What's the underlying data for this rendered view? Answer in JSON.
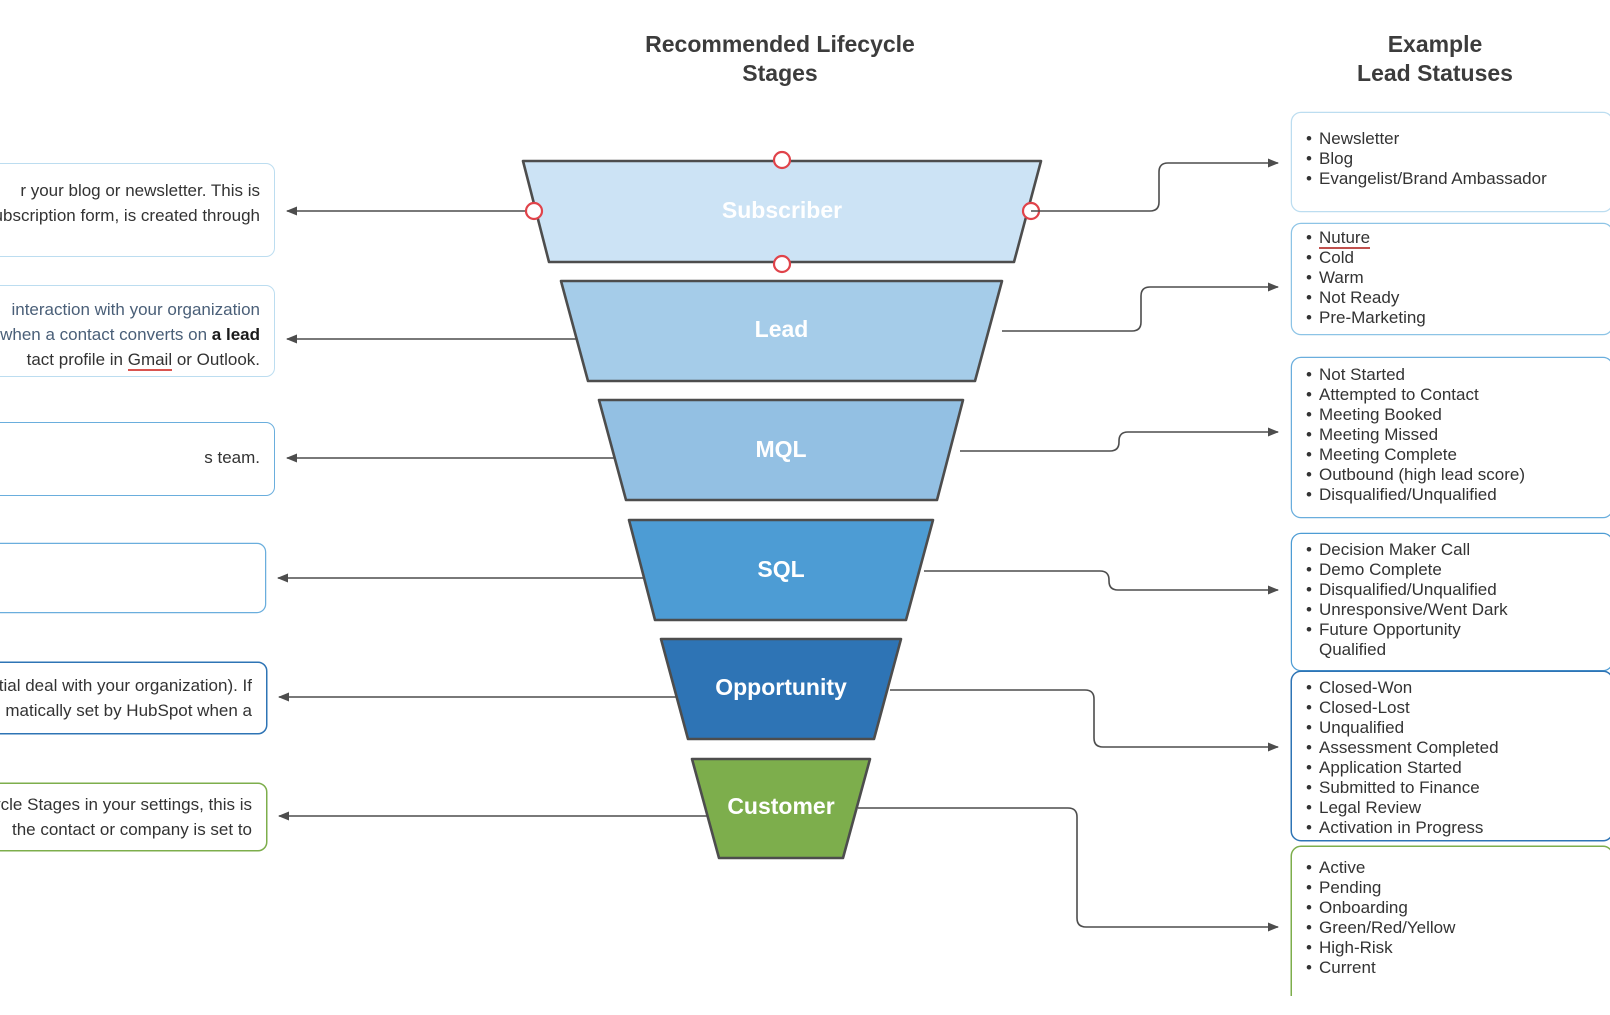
{
  "headers": {
    "funnel": "Recommended Lifecycle\nStages",
    "statuses": "Example\nLead Statuses"
  },
  "colors": {
    "subscriber": "#cce3f5",
    "lead": "#a5cce9",
    "mql": "#93c0e3",
    "sql": "#4d9cd4",
    "opportunity": "#2e74b5",
    "customer": "#7dae4c",
    "shape_stroke": "#4d4d4d",
    "connector": "#595959",
    "handle_red": "#e0434a",
    "box_border_light": "#bcddf0",
    "box_border_mid": "#6aaedd",
    "box_border_blue": "#2e74b5",
    "box_border_green": "#7dae4c",
    "text": "#333333",
    "spellcheck_underline": "#c0504d"
  },
  "funnel": {
    "stages": [
      {
        "id": "subscriber",
        "label": "Subscriber",
        "font_size": 23,
        "selected": true
      },
      {
        "id": "lead",
        "label": "Lead",
        "font_size": 23,
        "selected": false
      },
      {
        "id": "mql",
        "label": "MQL",
        "font_size": 23,
        "selected": false
      },
      {
        "id": "sql",
        "label": "SQL",
        "font_size": 23,
        "selected": false
      },
      {
        "id": "opportunity",
        "label": "Opportunity",
        "font_size": 23,
        "selected": false
      },
      {
        "id": "customer",
        "label": "Customer",
        "font_size": 23,
        "selected": false
      }
    ]
  },
  "descriptions": [
    {
      "id": "subscriber-description",
      "lines": [
        [
          {
            "t": "r your blog or newsletter. This is",
            "s": "normal"
          }
        ],
        [
          {
            "t": "ubscription form, is created through",
            "s": "normal"
          }
        ]
      ]
    },
    {
      "id": "lead-description",
      "lines": [
        [
          {
            "t": "interaction with your organization",
            "s": "dim"
          }
        ],
        [
          {
            "t": "when a contact converts on ",
            "s": "dim"
          },
          {
            "t": "a lead",
            "s": "bold"
          }
        ],
        [
          {
            "t": "tact profile in ",
            "s": "normal"
          },
          {
            "t": "Gmail",
            "s": "spell"
          },
          {
            "t": " or Outlook.",
            "s": "normal"
          }
        ]
      ]
    },
    {
      "id": "mql-description",
      "lines": [
        [
          {
            "t": "s team.",
            "s": "normal"
          }
        ]
      ]
    },
    {
      "id": "sql-description",
      "lines": []
    },
    {
      "id": "opportunity-description",
      "lines": [
        [
          {
            "t": "ential deal with your organization). If",
            "s": "normal"
          }
        ],
        [
          {
            "t": "matically set by HubSpot when a",
            "s": "normal"
          }
        ]
      ]
    },
    {
      "id": "customer-description",
      "lines": [
        [
          {
            "t": "cycle Stages in your settings, this is",
            "s": "normal"
          }
        ],
        [
          {
            "t": "the contact or company is set to",
            "s": "normal"
          }
        ]
      ]
    }
  ],
  "status_boxes": [
    {
      "id": "subscriber-statuses",
      "items": [
        {
          "text": "Newsletter"
        },
        {
          "text": "Blog"
        },
        {
          "text": "Evangelist/Brand Ambassador"
        }
      ]
    },
    {
      "id": "lead-statuses",
      "items": [
        {
          "text": "Nuture",
          "spellcheck": true
        },
        {
          "text": "Cold"
        },
        {
          "text": "Warm"
        },
        {
          "text": "Not Ready"
        },
        {
          "text": "Pre-Marketing"
        }
      ]
    },
    {
      "id": "mql-statuses",
      "items": [
        {
          "text": "Not Started"
        },
        {
          "text": "Attempted to Contact"
        },
        {
          "text": "Meeting Booked"
        },
        {
          "text": "Meeting Missed"
        },
        {
          "text": "Meeting Complete"
        },
        {
          "text": "Outbound (high lead score)"
        },
        {
          "text": "Disqualified/Unqualified"
        }
      ]
    },
    {
      "id": "sql-statuses",
      "items": [
        {
          "text": "Decision Maker Call"
        },
        {
          "text": "Demo Complete"
        },
        {
          "text": "Disqualified/Unqualified"
        },
        {
          "text": "Unresponsive/Went Dark"
        },
        {
          "text": "Future Opportunity"
        },
        {
          "text": "Qualified",
          "continuation": true
        }
      ]
    },
    {
      "id": "opportunity-statuses",
      "items": [
        {
          "text": "Closed-Won"
        },
        {
          "text": "Closed-Lost"
        },
        {
          "text": "Unqualified"
        },
        {
          "text": "Assessment Completed"
        },
        {
          "text": "Application Started"
        },
        {
          "text": "Submitted to Finance"
        },
        {
          "text": "Legal Review"
        },
        {
          "text": "Activation in Progress"
        }
      ]
    },
    {
      "id": "customer-statuses",
      "items": [
        {
          "text": "Active"
        },
        {
          "text": "Pending"
        },
        {
          "text": "Onboarding"
        },
        {
          "text": "Green/Red/Yellow"
        },
        {
          "text": "High-Risk"
        },
        {
          "text": "Current"
        }
      ]
    }
  ]
}
